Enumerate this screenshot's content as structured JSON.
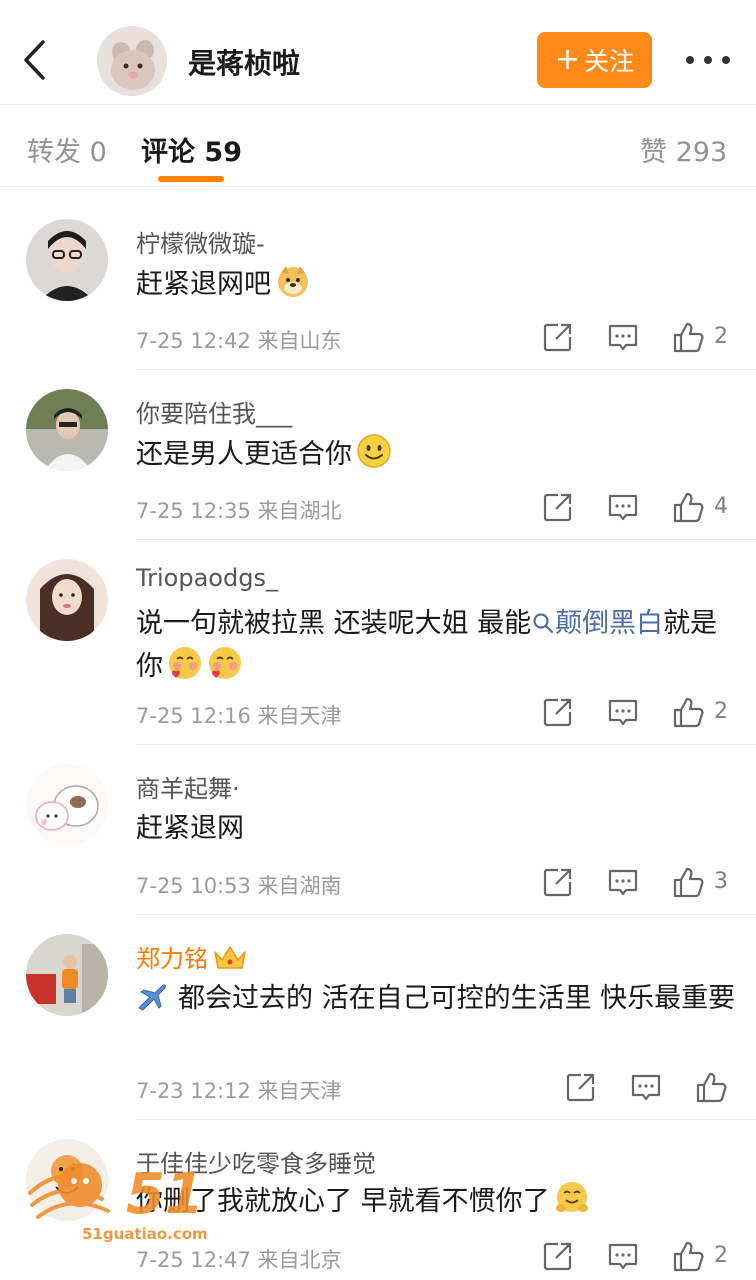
{
  "header": {
    "username": "是蒋桢啦",
    "follow_label": "关注",
    "follow_plus": "+"
  },
  "tabs": [
    {
      "label": "转发",
      "count": "0"
    },
    {
      "label": "评论",
      "count": "59"
    },
    {
      "label": "赞",
      "count": "293"
    }
  ],
  "comments": [
    {
      "name": "柠檬微微璇-",
      "text": "赶紧退网吧",
      "emoji": "doge-icon",
      "time": "7-25 12:42",
      "location": "来自山东",
      "likes": "2"
    },
    {
      "name": "你要陪住我___",
      "text": "还是男人更适合你",
      "emoji": "smile-icon",
      "time": "7-25 12:35",
      "location": "来自湖北",
      "likes": "4"
    },
    {
      "name": "Triopaodgs_",
      "text_before": "说一句就被拉黑 还装呢大姐 最能",
      "topic": "颠倒黑白",
      "text_after": "就是你",
      "time": "7-25 12:16",
      "location": "来自天津",
      "likes": "2"
    },
    {
      "name": "商羊起舞·",
      "text": "赶紧退网",
      "time": "7-25 10:53",
      "location": "来自湖南",
      "likes": "3"
    },
    {
      "name": "郑力铭",
      "text": "都会过去的  活在自己可控的生活里 快乐最重要",
      "time": "7-23 12:12",
      "location": "来自天津",
      "likes": ""
    },
    {
      "name": "于佳佳少吃零食多睡觉",
      "text": "你删了我就放心了 早就看不惯你了",
      "time": "7-25 12:47",
      "location": "来自北京",
      "likes": "2"
    }
  ],
  "watermark": {
    "brand": "51",
    "site": "51guatiao.com"
  },
  "colors": {
    "accent": "#ff8200",
    "follow_bg": "#ff8a17",
    "vip_name": "#ff7b00",
    "link": "#4b6ea8"
  }
}
